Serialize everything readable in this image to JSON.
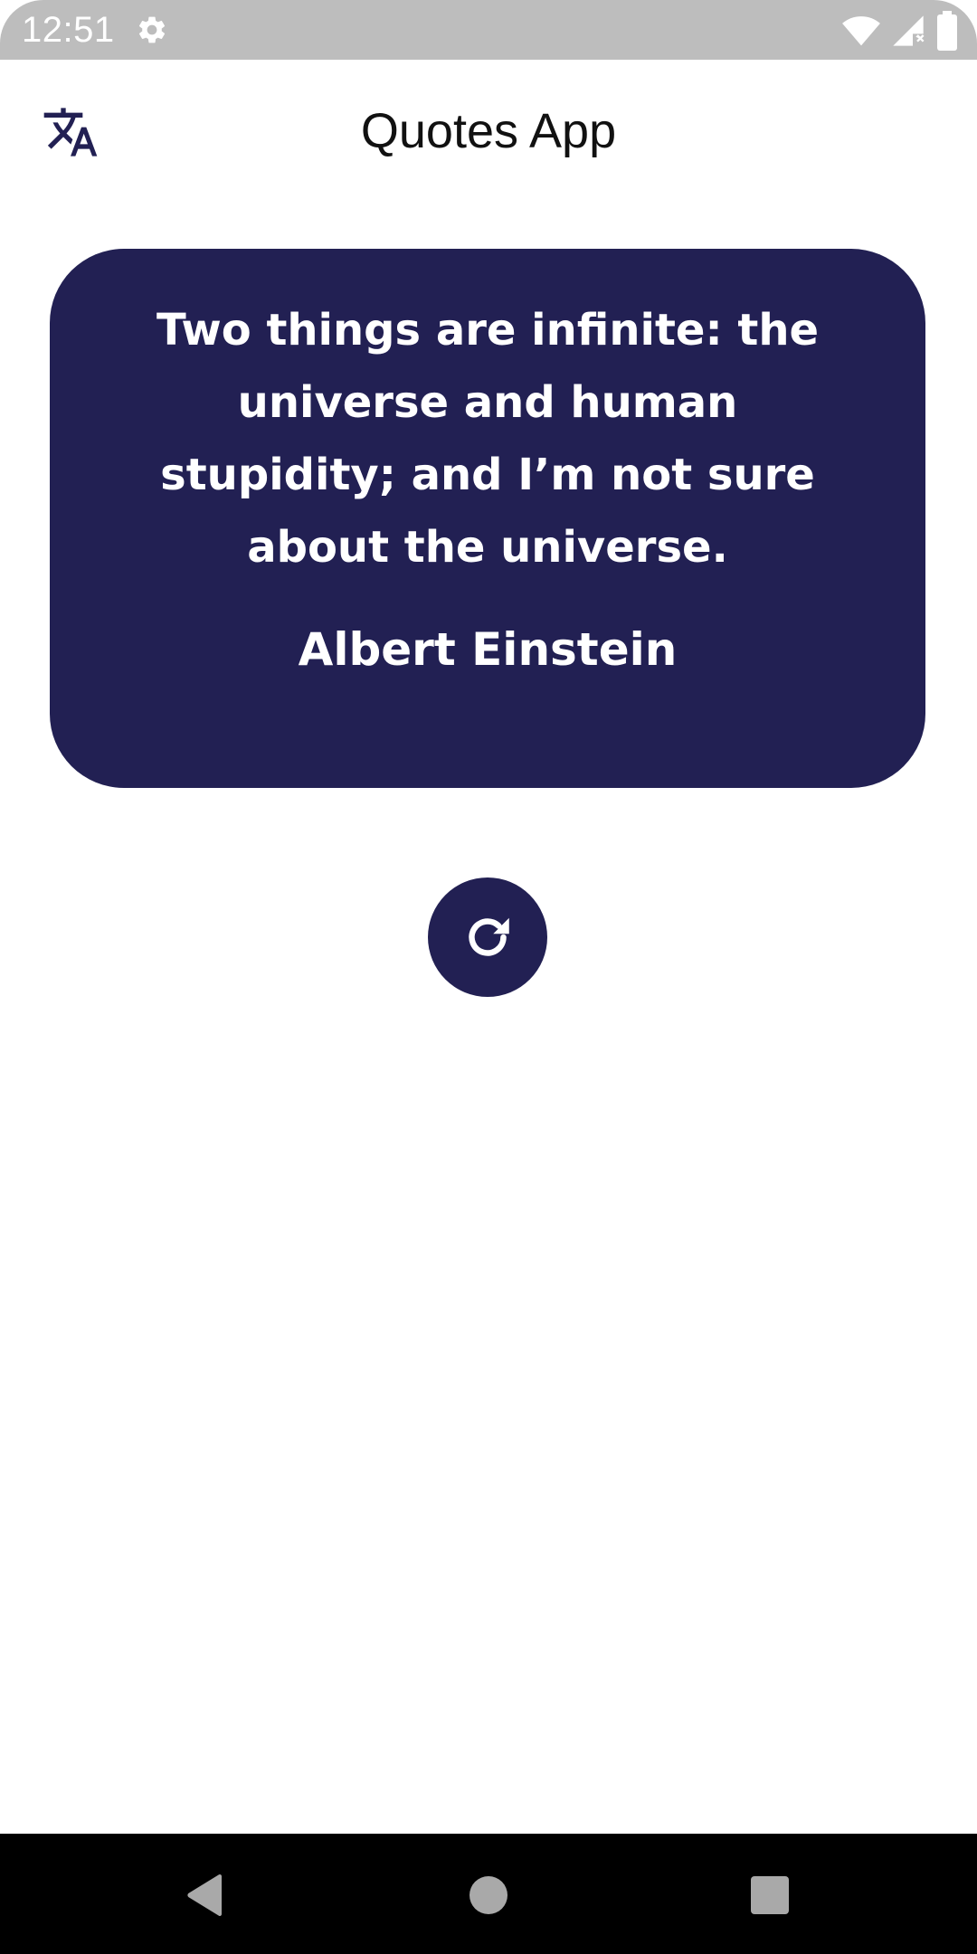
{
  "status_bar": {
    "time": "12:51",
    "icons": [
      "settings-gear-icon",
      "wifi-icon",
      "cellular-signal-icon",
      "battery-icon"
    ]
  },
  "app_bar": {
    "title": "Quotes App",
    "translate_icon": "translate-icon"
  },
  "quote": {
    "text": "Two things are infinite: the universe and human stupidity; and I’m not sure about the universe.",
    "author": "Albert Einstein"
  },
  "refresh_button": {
    "icon": "refresh-icon"
  },
  "nav_bar": {
    "icons": [
      "back-icon",
      "home-icon",
      "recents-icon"
    ]
  },
  "colors": {
    "card_background": "#222053",
    "accent": "#222053",
    "status_bar": "#bdbdbd",
    "nav_bar": "#000000",
    "text_on_card": "#ffffff"
  }
}
